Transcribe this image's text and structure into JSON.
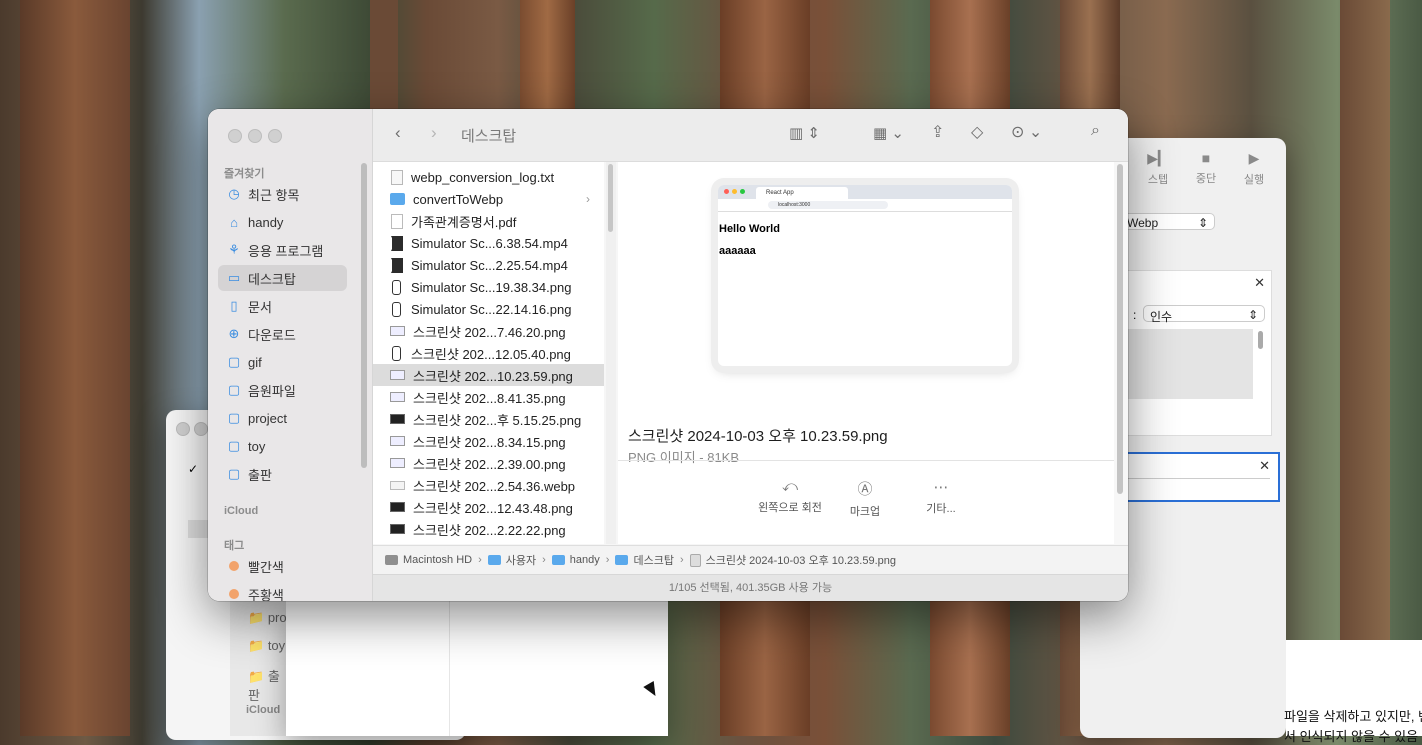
{
  "background_window": {
    "toolbar": {
      "step": "스텝",
      "stop": "중단",
      "run": "실행"
    },
    "select1_value": "Webp",
    "select2_label": "인수",
    "text_line1": "파일을 삭제하고 있지만, 변",
    "text_line2": "서 인식되지 않을 수 있음"
  },
  "left_window": {
    "sidebar": {
      "items": [
        "pro",
        "toy",
        "출판"
      ],
      "section": "iCloud"
    }
  },
  "finder": {
    "title": "데스크탑",
    "sidebar": {
      "favorites_title": "즐겨찾기",
      "favorites": [
        {
          "label": "최근 항목",
          "icon": "clock-icon"
        },
        {
          "label": "handy",
          "icon": "home-icon"
        },
        {
          "label": "응용 프로그램",
          "icon": "apps-icon"
        },
        {
          "label": "데스크탑",
          "icon": "desktop-icon",
          "selected": true
        },
        {
          "label": "문서",
          "icon": "document-icon"
        },
        {
          "label": "다운로드",
          "icon": "download-icon"
        },
        {
          "label": "gif",
          "icon": "folder-icon"
        },
        {
          "label": "음원파일",
          "icon": "folder-icon"
        },
        {
          "label": "project",
          "icon": "folder-icon"
        },
        {
          "label": "toy",
          "icon": "folder-icon"
        },
        {
          "label": "출판",
          "icon": "folder-icon"
        }
      ],
      "icloud_title": "iCloud",
      "tags_title": "태그",
      "tags": [
        {
          "label": "빨간색",
          "color": "#f2a36b"
        },
        {
          "label": "주황색",
          "color": "#f2a36b"
        }
      ]
    },
    "files": [
      {
        "name": "webp_conversion_log.txt",
        "type": "txt"
      },
      {
        "name": "convertToWebp",
        "type": "folder",
        "has_children": true
      },
      {
        "name": "가족관계증명서.pdf",
        "type": "pdf"
      },
      {
        "name": "Simulator Sc...6.38.54.mp4",
        "type": "vid"
      },
      {
        "name": "Simulator Sc...2.25.54.mp4",
        "type": "vid"
      },
      {
        "name": "Simulator Sc...19.38.34.png",
        "type": "phone"
      },
      {
        "name": "Simulator Sc...22.14.16.png",
        "type": "phone"
      },
      {
        "name": "스크린샷 202...7.46.20.png",
        "type": "wide"
      },
      {
        "name": "스크린샷 202...12.05.40.png",
        "type": "phone"
      },
      {
        "name": "스크린샷 202...10.23.59.png",
        "type": "wide",
        "selected": true
      },
      {
        "name": "스크린샷 202...8.41.35.png",
        "type": "wide"
      },
      {
        "name": "스크린샷 202...후 5.15.25.png",
        "type": "dark"
      },
      {
        "name": "스크린샷 202...8.34.15.png",
        "type": "wide"
      },
      {
        "name": "스크린샷 202...2.39.00.png",
        "type": "wide"
      },
      {
        "name": "스크린샷 202...2.54.36.webp",
        "type": "webp"
      },
      {
        "name": "스크린샷 202...12.43.48.png",
        "type": "dark"
      },
      {
        "name": "스크린샷 202...2.22.22.png",
        "type": "dark"
      }
    ],
    "preview": {
      "browser_tab": "React App",
      "browser_url": "localhost:3000",
      "page_heading": "Hello World",
      "page_text": "aaaaaa",
      "file_name": "스크린샷 2024-10-03 오후 10.23.59.png",
      "file_kind": "PNG 이미지 - 81KB",
      "actions": [
        {
          "label": "왼쪽으로 회전",
          "icon": "rotate-left-icon",
          "glyph": "⤺"
        },
        {
          "label": "마크업",
          "icon": "markup-icon",
          "glyph": "Ⓐ"
        },
        {
          "label": "기타...",
          "icon": "more-icon",
          "glyph": "⋯"
        }
      ]
    },
    "path": [
      "Macintosh HD",
      "사용자",
      "handy",
      "데스크탑",
      "스크린샷 2024-10-03 오후 10.23.59.png"
    ],
    "status": "1/105 선택됨, 401.35GB 사용 가능"
  }
}
